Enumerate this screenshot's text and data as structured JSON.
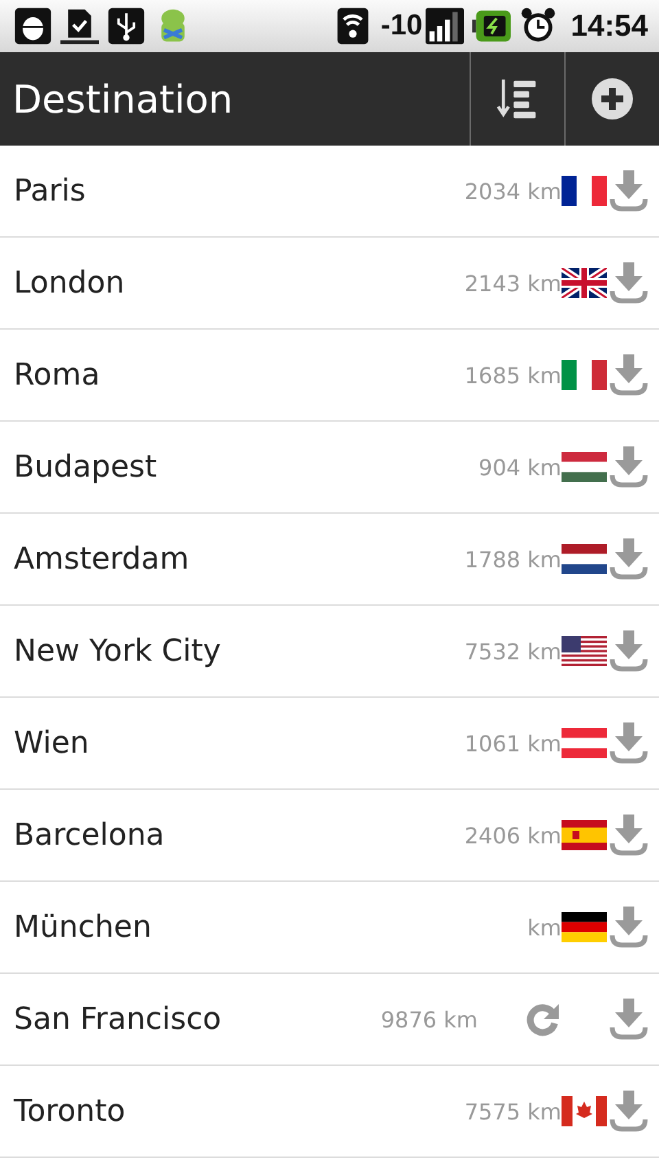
{
  "status_bar": {
    "signal_text": "-10",
    "time": "14:54"
  },
  "action_bar": {
    "title": "Destination"
  },
  "destinations": [
    {
      "name": "Paris",
      "distance": "2034 km",
      "kind": "france"
    },
    {
      "name": "London",
      "distance": "2143 km",
      "kind": "britain"
    },
    {
      "name": "Roma",
      "distance": "1685 km",
      "kind": "italy"
    },
    {
      "name": "Budapest",
      "distance": "904 km",
      "kind": "hungary"
    },
    {
      "name": "Amsterdam",
      "distance": "1788 km",
      "kind": "netherlands"
    },
    {
      "name": "New York City",
      "distance": "7532 km",
      "kind": "usa"
    },
    {
      "name": "Wien",
      "distance": "1061 km",
      "kind": "austria"
    },
    {
      "name": "Barcelona",
      "distance": "2406 km",
      "kind": "spain"
    },
    {
      "name": "München",
      "distance": "km",
      "kind": "germany"
    },
    {
      "name": "San Francisco",
      "distance": "9876 km",
      "kind": "loading"
    },
    {
      "name": "Toronto",
      "distance": "7575 km",
      "kind": "canada"
    }
  ]
}
